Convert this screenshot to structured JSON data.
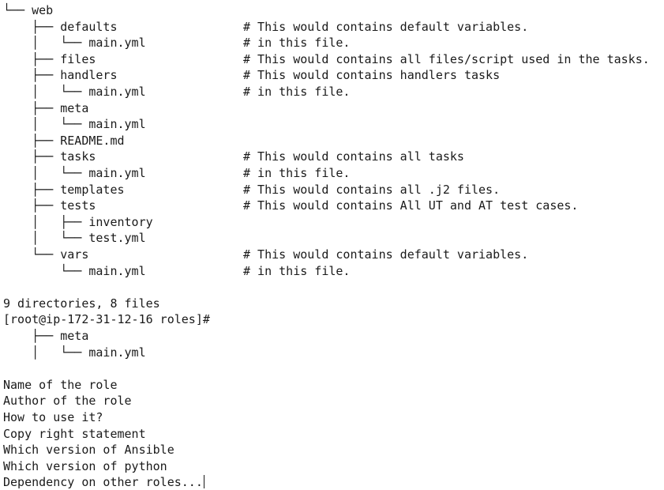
{
  "terminal": {
    "lines": [
      {
        "text": "└── web",
        "comment": ""
      },
      {
        "text": "    ├── defaults",
        "comment": "# This would contains default variables."
      },
      {
        "text": "    │   └── main.yml",
        "comment": "# in this file."
      },
      {
        "text": "    ├── files",
        "comment": "# This would contains all files/script used in the tasks."
      },
      {
        "text": "    ├── handlers",
        "comment": "# This would contains handlers tasks"
      },
      {
        "text": "    │   └── main.yml",
        "comment": "# in this file."
      },
      {
        "text": "    ├── meta",
        "comment": ""
      },
      {
        "text": "    │   └── main.yml",
        "comment": ""
      },
      {
        "text": "    ├── README.md",
        "comment": ""
      },
      {
        "text": "    ├── tasks",
        "comment": "# This would contains all tasks"
      },
      {
        "text": "    │   └── main.yml",
        "comment": "# in this file."
      },
      {
        "text": "    ├── templates",
        "comment": "# This would contains all .j2 files."
      },
      {
        "text": "    ├── tests",
        "comment": "# This would contains All UT and AT test cases."
      },
      {
        "text": "    │   ├── inventory",
        "comment": ""
      },
      {
        "text": "    │   └── test.yml",
        "comment": ""
      },
      {
        "text": "    └── vars",
        "comment": "# This would contains default variables."
      },
      {
        "text": "        └── main.yml",
        "comment": "# in this file."
      },
      {
        "text": "",
        "comment": ""
      },
      {
        "text": "9 directories, 8 files",
        "comment": ""
      },
      {
        "text": "[root@ip-172-31-12-16 roles]#",
        "comment": ""
      },
      {
        "text": "    ├── meta",
        "comment": ""
      },
      {
        "text": "    │   └── main.yml",
        "comment": ""
      },
      {
        "text": "",
        "comment": ""
      },
      {
        "text": "Name of the role",
        "comment": ""
      },
      {
        "text": "Author of the role",
        "comment": ""
      },
      {
        "text": "How to use it?",
        "comment": ""
      },
      {
        "text": "Copy right statement",
        "comment": ""
      },
      {
        "text": "Which version of Ansible",
        "comment": ""
      },
      {
        "text": "Which version of python",
        "comment": ""
      },
      {
        "text": "Dependency on other roles...",
        "comment": ""
      }
    ]
  }
}
